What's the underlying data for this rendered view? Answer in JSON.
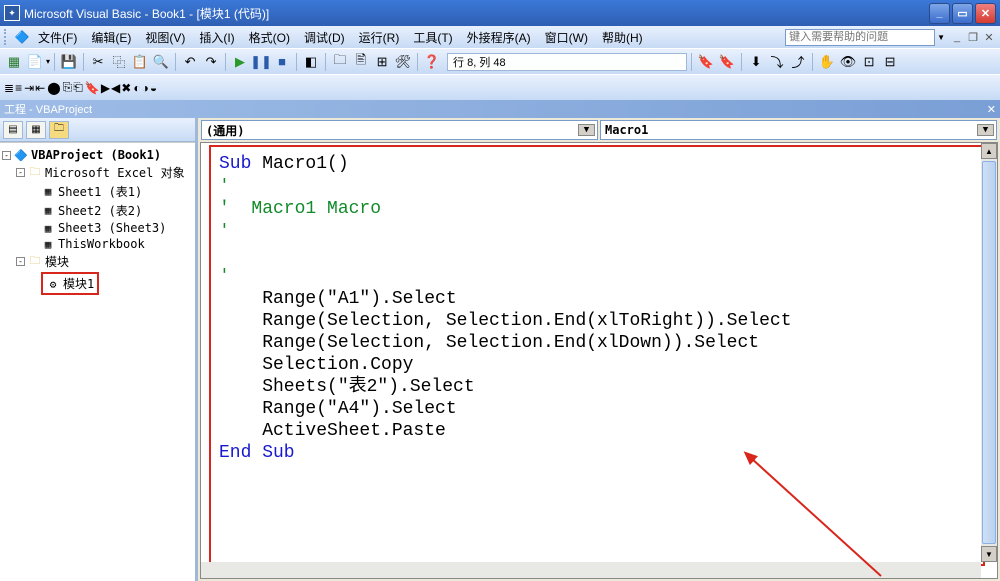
{
  "titlebar": {
    "title": "Microsoft Visual Basic - Book1 - [模块1 (代码)]"
  },
  "menubar": {
    "items": [
      {
        "label": "文件(F)"
      },
      {
        "label": "编辑(E)"
      },
      {
        "label": "视图(V)"
      },
      {
        "label": "插入(I)"
      },
      {
        "label": "格式(O)"
      },
      {
        "label": "调试(D)"
      },
      {
        "label": "运行(R)"
      },
      {
        "label": "工具(T)"
      },
      {
        "label": "外接程序(A)"
      },
      {
        "label": "窗口(W)"
      },
      {
        "label": "帮助(H)"
      }
    ],
    "help_placeholder": "键入需要帮助的问题"
  },
  "toolbar": {
    "status": "行 8, 列 48"
  },
  "project_panel": {
    "title": "工程 - VBAProject",
    "root": "VBAProject (Book1)",
    "folder_excel": "Microsoft Excel 对象",
    "sheets": [
      {
        "label": "Sheet1 (表1)"
      },
      {
        "label": "Sheet2 (表2)"
      },
      {
        "label": "Sheet3 (Sheet3)"
      },
      {
        "label": "ThisWorkbook"
      }
    ],
    "folder_modules": "模块",
    "module": "模块1"
  },
  "dropdowns": {
    "object": "(通用)",
    "proc": "Macro1"
  },
  "code": {
    "l1_a": "Sub",
    "l1_b": " Macro1()",
    "l2": "'",
    "l3": "'  Macro1 Macro",
    "l4": "'",
    "l5": "",
    "l6": "'",
    "l7": "    Range(\"A1\").Select",
    "l8": "    Range(Selection, Selection.End(xlToRight)).Select",
    "l9": "    Range(Selection, Selection.End(xlDown)).Select",
    "l10": "    Selection.Copy",
    "l11": "    Sheets(\"表2\").Select",
    "l12": "    Range(\"A4\").Select",
    "l13": "    ActiveSheet.Paste",
    "l14": "End Sub"
  }
}
